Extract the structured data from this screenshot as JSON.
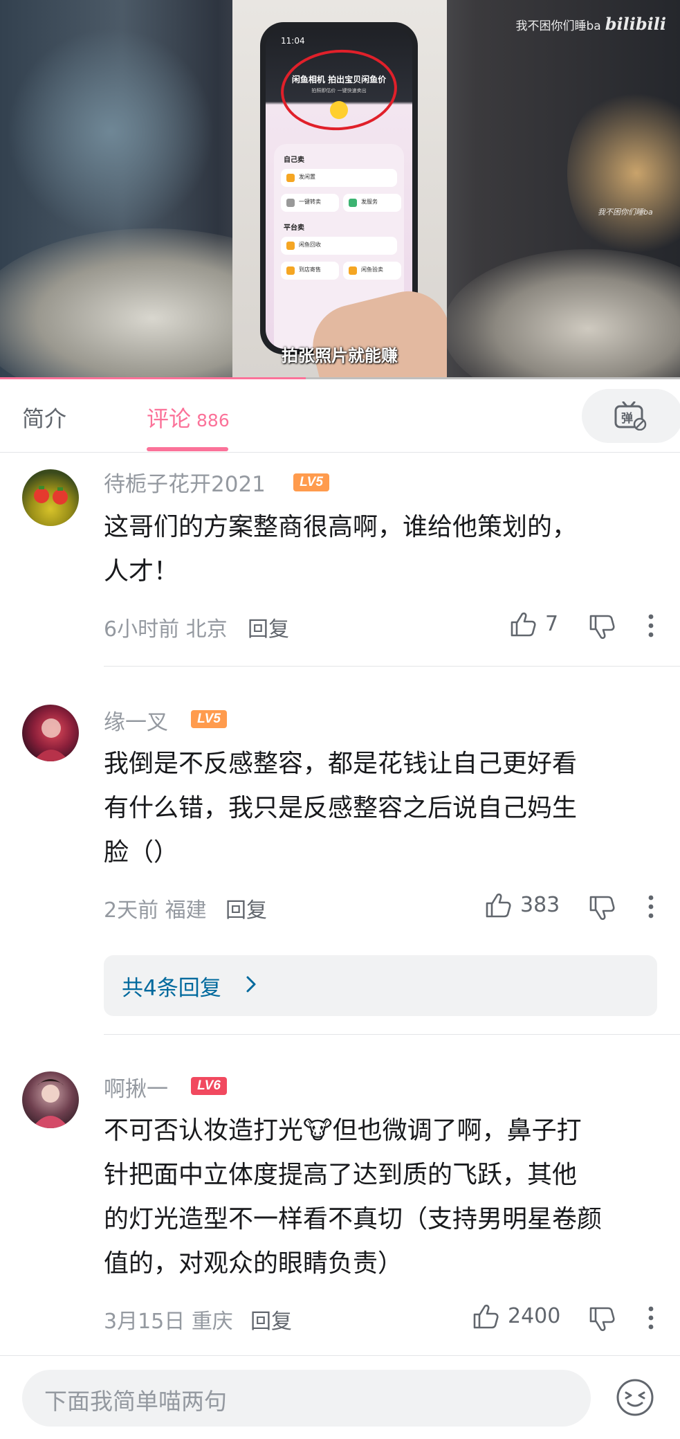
{
  "video": {
    "phone_time": "11:04",
    "phone_promo_title": "闲鱼相机 拍出宝贝闲鱼价",
    "phone_promo_sub": "拍照即估价 一键快速卖出",
    "panel_section_self": "自己卖",
    "panel_item_1": "发闲置",
    "panel_item_2": "一键转卖",
    "panel_item_3": "发服务",
    "panel_section_platform": "平台卖",
    "panel_item_4": "闲鱼回收",
    "panel_item_5": "到店寄售",
    "panel_item_6": "闲鱼验卖",
    "subtitle": "拍张照片就能赚",
    "watermark_user": "我不困你们睡ba",
    "watermark_brand": "bilibili",
    "signature": "我不困你们睡ba",
    "progress": 0.45
  },
  "tabs": {
    "intro_label": "简介",
    "comments_label": "评论",
    "comments_count": "886",
    "danmaku_icon": "danmaku-off-icon"
  },
  "comments": [
    {
      "username": "待栀子花开2021",
      "level": "LV5",
      "lines": [
        "这哥们的方案整商很高啊，谁给他策划的，",
        "人才！"
      ],
      "time": "6小时前",
      "location": "北京",
      "reply_label": "回复",
      "likes": "7"
    },
    {
      "username": "缘一叉",
      "level": "LV5",
      "lines": [
        "我倒是不反感整容，都是花钱让自己更好看",
        "有什么错，我只是反感整容之后说自己妈生",
        "脸（）"
      ],
      "time": "2天前",
      "location": "福建",
      "reply_label": "回复",
      "likes": "383",
      "replies_summary": "共4条回复"
    },
    {
      "username": "啊揪一",
      "level": "LV6",
      "lines": [
        "不可否认妆造打光🐮但也微调了啊，鼻子打",
        "针把面中立体度提高了达到质的飞跃，其他",
        "的灯光造型不一样看不真切（支持男明星卷颜",
        "值的，对观众的眼睛负责）"
      ],
      "time": "3月15日",
      "location": "重庆",
      "reply_label": "回复",
      "likes": "2400"
    }
  ],
  "bottom": {
    "input_placeholder": "下面我简单喵两句",
    "emoji_icon": "emoji-icon"
  },
  "colors": {
    "accent_pink": "#fb7299",
    "lv5": "#ff9b4d",
    "lv6": "#f1495f",
    "link_blue": "#00699d"
  }
}
